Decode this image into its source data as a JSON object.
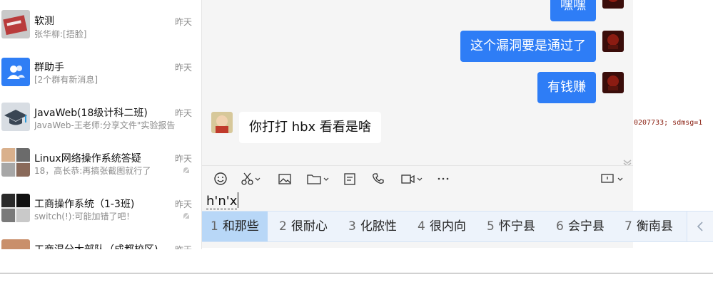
{
  "conversations": [
    {
      "name": "软测",
      "preview": "张华柳:[捂脸]",
      "time": "昨天",
      "avatar_icon": "photo-avatar"
    },
    {
      "name": "群助手",
      "preview": "[2个群有新消息]",
      "time": "昨天",
      "avatar_icon": "group-assistant-icon"
    },
    {
      "name": "JavaWeb(18级计科二班)",
      "preview": "JavaWeb-王老师:分享文件\"实验报告",
      "time": "昨天",
      "avatar_icon": "graduation-cap-icon"
    },
    {
      "name": "Linux网络操作系统答疑",
      "preview": "18，高长恭:再搞张截图就行了",
      "time": "昨天",
      "avatar_icon": "group-photo-avatar",
      "muted": true
    },
    {
      "name": "工商操作系统（1-3班)",
      "preview": "switch(!):可能加错了吧！",
      "time": "昨天",
      "avatar_icon": "group-photo-avatar",
      "muted": true
    },
    {
      "name": "工商混分大部队（成都校区)",
      "preview": "",
      "time": "昨天",
      "avatar_icon": "group-photo-avatar"
    }
  ],
  "messages": [
    {
      "side": "right",
      "text": "嘿嘿"
    },
    {
      "side": "right",
      "text": "这个漏洞要是通过了"
    },
    {
      "side": "right",
      "text": "有钱赚"
    },
    {
      "side": "left",
      "text": "你打打 hbx 看看是啥"
    }
  ],
  "toolbar": {
    "icons": [
      "emoji-icon",
      "scissors-icon",
      "image-icon",
      "folder-icon",
      "document-icon",
      "phone-icon",
      "video-icon",
      "more-icon"
    ],
    "right_icon": "chat-window-icon"
  },
  "input": {
    "composition": "h'n'x"
  },
  "ime": {
    "candidates": [
      {
        "num": "1",
        "text": "和那些"
      },
      {
        "num": "2",
        "text": "很耐心"
      },
      {
        "num": "3",
        "text": "化脓性"
      },
      {
        "num": "4",
        "text": "很内向"
      },
      {
        "num": "5",
        "text": "怀宁县"
      },
      {
        "num": "6",
        "text": "会宁县"
      },
      {
        "num": "7",
        "text": "衡南县"
      }
    ],
    "prev_icon": "chevron-left-icon"
  },
  "background_text": "0207733; sdmsg=1",
  "colors": {
    "accent": "#2e7df6",
    "ime_active": "#b8d7f7",
    "chat_bg": "#f5f5f5"
  }
}
